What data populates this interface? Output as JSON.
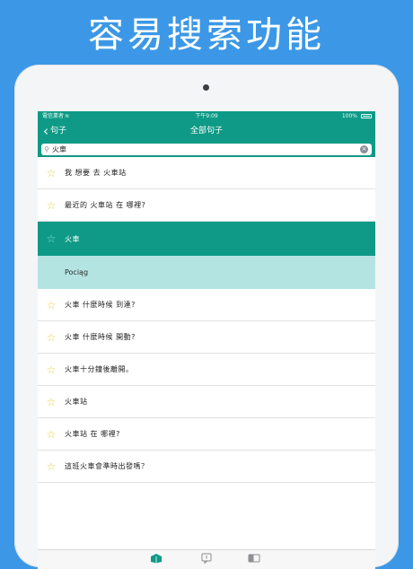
{
  "headline": "容易搜索功能",
  "status": {
    "carrier": "電信業者",
    "wifi": "≋",
    "time": "下午9:09",
    "battery": "100%"
  },
  "nav": {
    "back_label": "句子",
    "title": "全部句子"
  },
  "search": {
    "value": "火車"
  },
  "rows": [
    {
      "text": "我 想要 去 火車站"
    },
    {
      "text": "最近的 火車站 在 哪裡?"
    },
    {
      "text": "火車",
      "selected": true
    },
    {
      "text": "火車 什麼時候 到達?"
    },
    {
      "text": "火車 什麼時候 開動?"
    },
    {
      "text": "火車十分鐘後離開。"
    },
    {
      "text": "火車站"
    },
    {
      "text": "火車站 在 哪裡?"
    },
    {
      "text": "這班火車會準時出發嗎？"
    }
  ],
  "translation": "Pociąg",
  "icons": {
    "star": "star-outline-icon",
    "search": "search-icon",
    "clear": "clear-icon"
  },
  "colors": {
    "accent": "#0e9a86",
    "translation_bg": "#b4e4e2",
    "star": "#e6cf45",
    "backdrop": "#3c98e6"
  }
}
